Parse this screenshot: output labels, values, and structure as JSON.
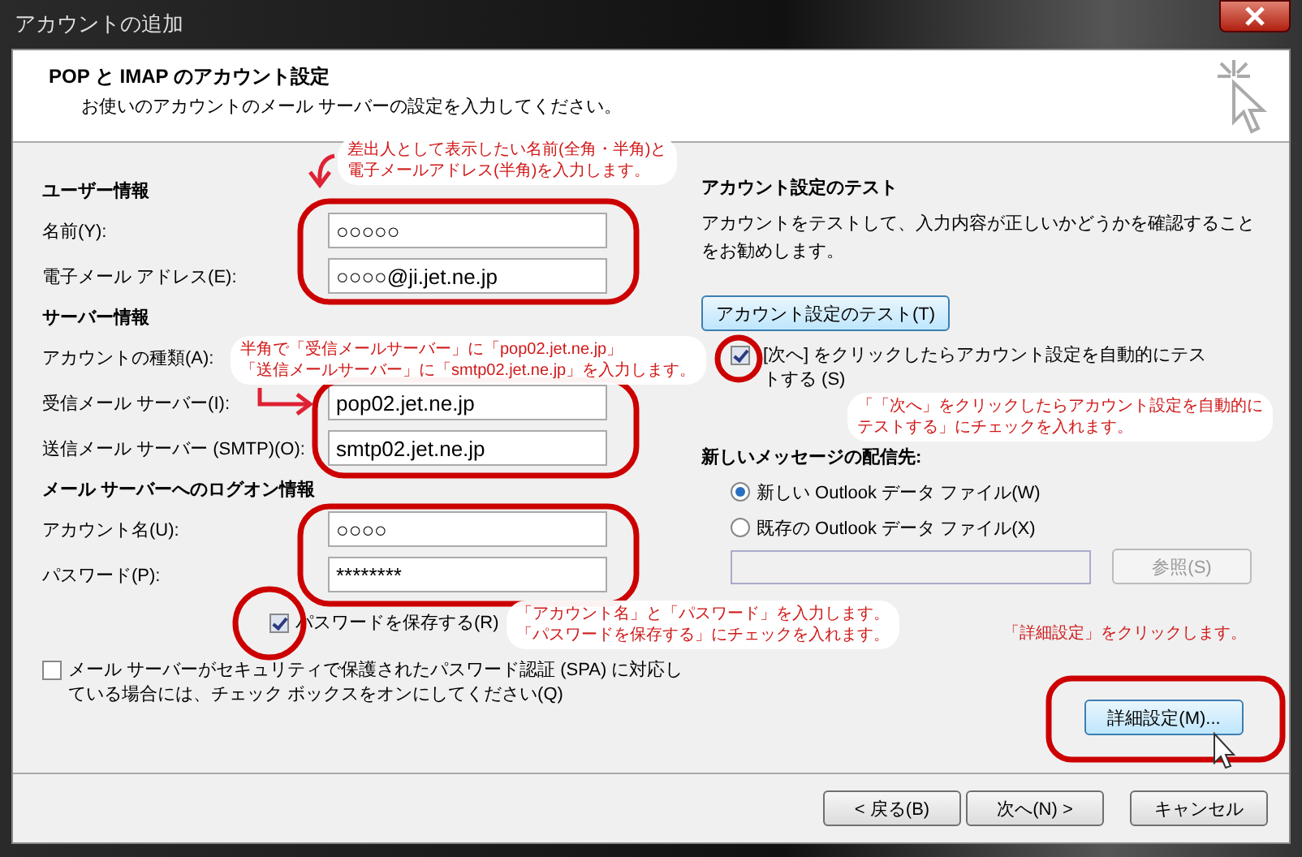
{
  "window": {
    "title": "アカウントの追加"
  },
  "header": {
    "title": "POP と IMAP のアカウント設定",
    "subtitle": "お使いのアカウントのメール サーバーの設定を入力してください。"
  },
  "user_info": {
    "heading": "ユーザー情報",
    "fields": [
      {
        "label": "名前(Y):",
        "value": "○○○○○"
      },
      {
        "label": "電子メール アドレス(E):",
        "value": "○○○○@ji.jet.ne.jp"
      }
    ]
  },
  "server_info": {
    "heading": "サーバー情報",
    "account_type_label": "アカウントの種類(A):",
    "fields": [
      {
        "label": "受信メール サーバー(I):",
        "value": "pop02.jet.ne.jp"
      },
      {
        "label": "送信メール サーバー (SMTP)(O):",
        "value": "smtp02.jet.ne.jp"
      }
    ]
  },
  "logon_info": {
    "heading": "メール サーバーへのログオン情報",
    "fields": [
      {
        "label": "アカウント名(U):",
        "value": "○○○○"
      },
      {
        "label": "パスワード(P):",
        "value": "********"
      }
    ],
    "remember_password": {
      "label": "パスワードを保存する(R)",
      "checked": true
    }
  },
  "spa": {
    "lines": [
      "メール サーバーがセキュリティで保護されたパスワード認証 (SPA) に対応し",
      "ている場合には、チェック ボックスをオンにしてください(Q)"
    ],
    "checked": false
  },
  "test": {
    "heading": "アカウント設定のテスト",
    "description": "アカウントをテストして、入力内容が正しいかどうかを確認することをお勧めします。",
    "button": "アカウント設定のテスト(T)",
    "auto_test": {
      "label": "[次へ] をクリックしたらアカウント設定を自動的にテストする (S)",
      "checked": true
    }
  },
  "delivery": {
    "heading": "新しいメッセージの配信先:",
    "options": [
      {
        "label": "新しい Outlook データ ファイル(W)",
        "selected": true
      },
      {
        "label": "既存の Outlook データ ファイル(X)",
        "selected": false
      }
    ],
    "browse_button": {
      "label": "参照(S)",
      "disabled": true
    }
  },
  "more_settings_button": "詳細設定(M)...",
  "buttons": [
    "< 戻る(B)",
    "次へ(N) >",
    "キャンセル"
  ],
  "annotations": [
    {
      "lines": [
        "差出人として表示したい名前(全角・半角)と",
        "電子メールアドレス(半角)を入力します。"
      ]
    },
    {
      "lines": [
        "半角で「受信メールサーバー」に「pop02.jet.ne.jp」",
        "「送信メールサーバー」に「smtp02.jet.ne.jp」を入力します。"
      ]
    },
    {
      "lines": [
        "「「次へ」をクリックしたらアカウント設定を自動的に",
        "テストする」にチェックを入れます。"
      ]
    },
    {
      "lines": [
        "「アカウント名」と「パスワード」を入力します。",
        "「パスワードを保存する」にチェックを入れます。"
      ]
    },
    {
      "lines": [
        "「詳細設定」をクリックします。"
      ]
    }
  ]
}
